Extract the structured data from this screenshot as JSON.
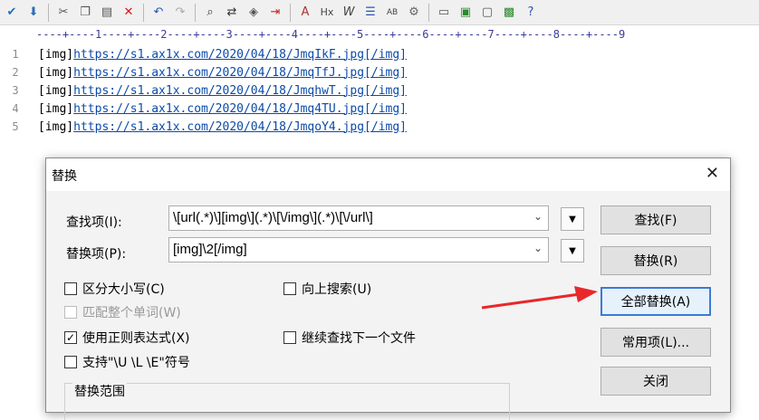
{
  "toolbar": {
    "icons": [
      "spellcheck-icon",
      "save-icon",
      "cut-icon",
      "copy-icon",
      "paste-icon",
      "delete-icon",
      "undo-icon",
      "redo-icon",
      "find-icon",
      "replace-icon",
      "format-icon",
      "indent-icon",
      "font-icon",
      "hex-icon",
      "wordwrap-icon",
      "sort-icon",
      "column-icon",
      "settings-icon",
      "view-icon",
      "compare-icon",
      "browser-icon",
      "export-icon",
      "help-icon"
    ]
  },
  "ruler": "----+----1----+----2----+----3----+----4----+----5----+----6----+----7----+----8----+----9",
  "editor": {
    "lines": [
      {
        "num": "1",
        "open": "[img]",
        "url": "https://s1.ax1x.com/2020/04/18/JmqIkF.jpg",
        "close": "[/img]"
      },
      {
        "num": "2",
        "open": "[img]",
        "url": "https://s1.ax1x.com/2020/04/18/JmqTfJ.jpg",
        "close": "[/img]"
      },
      {
        "num": "3",
        "open": "[img]",
        "url": "https://s1.ax1x.com/2020/04/18/JmqhwT.jpg",
        "close": "[/img]"
      },
      {
        "num": "4",
        "open": "[img]",
        "url": "https://s1.ax1x.com/2020/04/18/Jmq4TU.jpg",
        "close": "[/img]"
      },
      {
        "num": "5",
        "open": "[img]",
        "url": "https://s1.ax1x.com/2020/04/18/JmqoY4.jpg",
        "close": "[/img]"
      }
    ]
  },
  "dialog": {
    "title": "替换",
    "close_glyph": "✕",
    "find_label": "查找项(I):",
    "find_value": "\\[url(.*)\\][img\\](.*)\\[\\/img\\](.*)\\[\\/url\\]",
    "replace_label": "替换项(P):",
    "replace_value": "[img]\\2[/img]",
    "options": {
      "case": "区分大小写(C)",
      "whole_word": "匹配整个单词(W)",
      "regex": "使用正则表达式(X)",
      "escape": "支持\"\\U \\L \\E\"符号",
      "search_up": "向上搜索(U)",
      "next_file": "继续查找下一个文件"
    },
    "scope_label": "替换范围",
    "buttons": {
      "find": "查找(F)",
      "replace": "替换(R)",
      "replace_all": "全部替换(A)",
      "common": "常用项(L)...",
      "close": "关闭"
    }
  }
}
